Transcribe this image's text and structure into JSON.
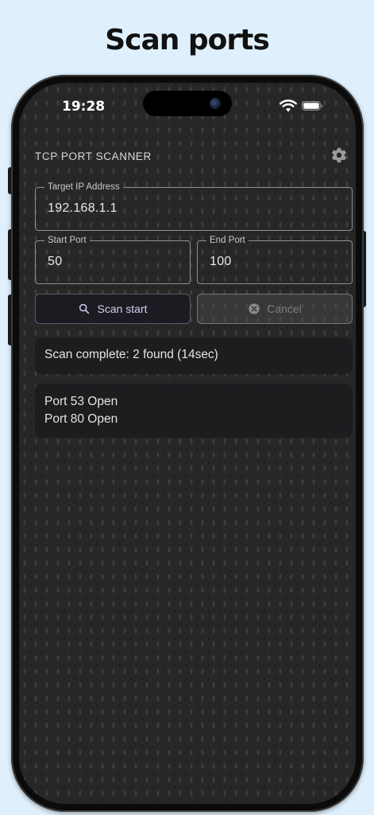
{
  "headline": "Scan ports",
  "status_bar": {
    "time": "19:28",
    "icons": [
      "wifi-icon",
      "battery-icon"
    ]
  },
  "app": {
    "title": "TCP PORT SCANNER",
    "settings_icon": "gear-icon"
  },
  "form": {
    "target_ip": {
      "label": "Target IP Address",
      "value": "192.168.1.1"
    },
    "start_port": {
      "label": "Start Port",
      "value": "50"
    },
    "end_port": {
      "label": "End Port",
      "value": "100"
    }
  },
  "actions": {
    "scan_label": "Scan start",
    "scan_icon": "search-icon",
    "cancel_label": "Cancel",
    "cancel_icon": "close-circle-icon",
    "cancel_enabled": false
  },
  "status": {
    "message": "Scan complete: 2 found (14sec)"
  },
  "results": {
    "items": [
      "Port 53 Open",
      "Port 80 Open"
    ]
  },
  "colors": {
    "page_background": "#dff0fc",
    "screen_background": "#272727",
    "card_background": "#1d1d20",
    "accent_text": "#d2d0f0"
  }
}
